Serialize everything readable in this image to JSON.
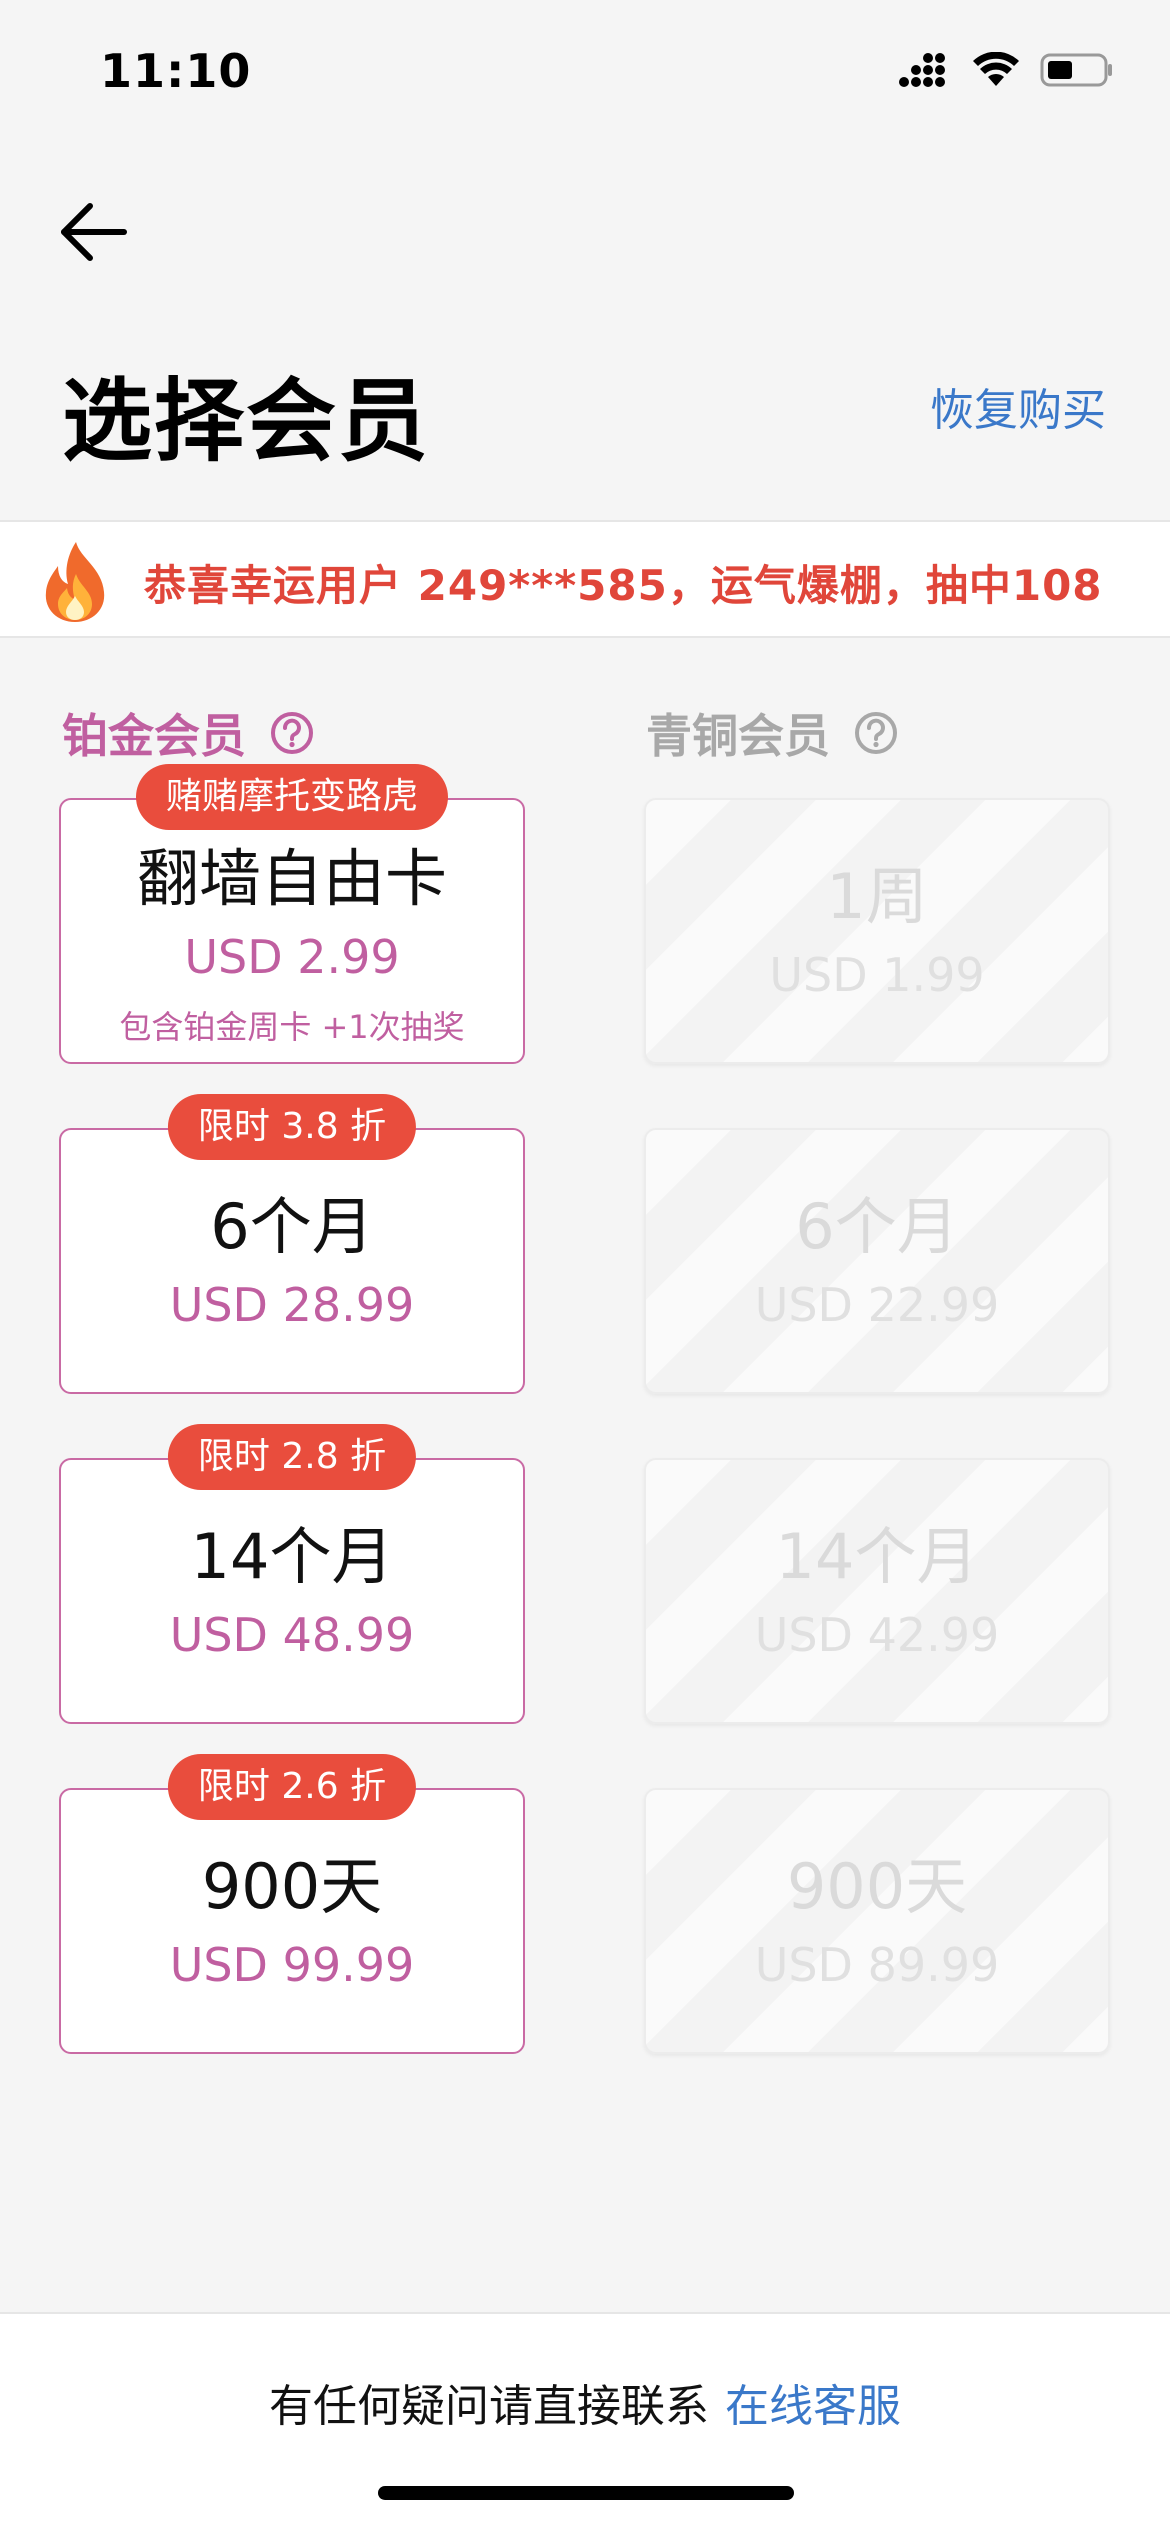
{
  "status_bar": {
    "time": "11:10"
  },
  "header": {
    "title": "选择会员",
    "restore_label": "恢复购买"
  },
  "announcement": {
    "text": "恭喜幸运用户 249***585，运气爆棚，抽中108"
  },
  "columns": {
    "platinum": {
      "label": "铂金会员"
    },
    "bronze": {
      "label": "青铜会员"
    }
  },
  "plans": {
    "platinum": [
      {
        "badge": "赌赌摩托变路虎",
        "title": "翻墙自由卡",
        "price": "USD 2.99",
        "note": "包含铂金周卡 +1次抽奖"
      },
      {
        "badge": "限时 3.8 折",
        "title": "6个月",
        "price": "USD 28.99"
      },
      {
        "badge": "限时 2.8 折",
        "title": "14个月",
        "price": "USD 48.99"
      },
      {
        "badge": "限时 2.6 折",
        "title": "900天",
        "price": "USD 99.99"
      }
    ],
    "bronze": [
      {
        "title": "1周",
        "price": "USD 1.99"
      },
      {
        "title": "6个月",
        "price": "USD 22.99"
      },
      {
        "title": "14个月",
        "price": "USD 42.99"
      },
      {
        "title": "900天",
        "price": "USD 89.99"
      }
    ]
  },
  "footer": {
    "text": "有任何疑问请直接联系",
    "link": "在线客服"
  },
  "colors": {
    "accent": "#c05fa0",
    "badge": "#e94d3d",
    "link": "#3a78c9",
    "announcement": "#e0463a"
  }
}
